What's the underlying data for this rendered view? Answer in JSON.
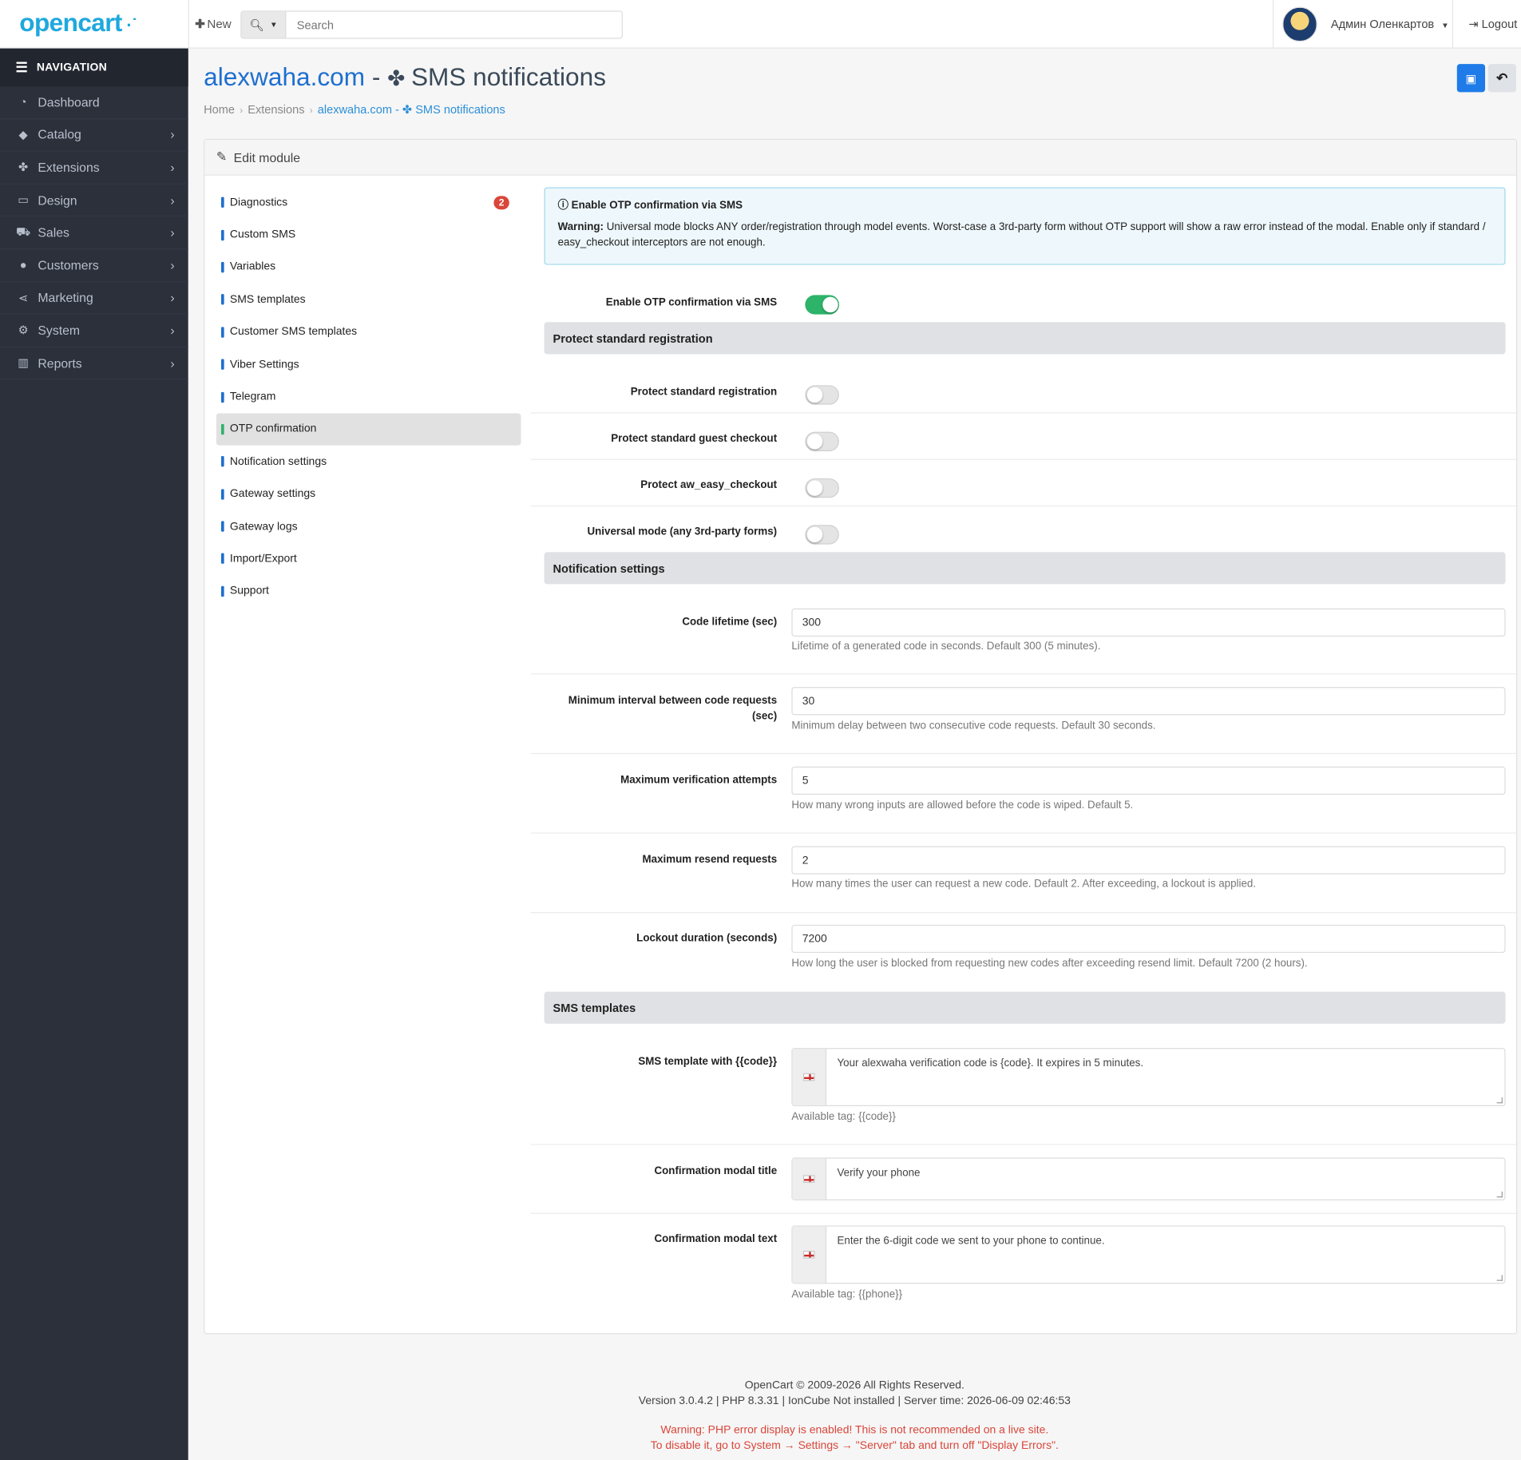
{
  "header": {
    "logo": "opencart",
    "new_label": "New",
    "search_placeholder": "Search",
    "user_name": "Админ Оленкартов",
    "logout_label": "Logout"
  },
  "navigation": {
    "title": "NAVIGATION",
    "items": [
      {
        "label": "Dashboard",
        "icon": "dashboard-icon"
      },
      {
        "label": "Catalog",
        "icon": "tags-icon"
      },
      {
        "label": "Extensions",
        "icon": "puzzle-icon"
      },
      {
        "label": "Design",
        "icon": "monitor-icon"
      },
      {
        "label": "Sales",
        "icon": "cart-icon"
      },
      {
        "label": "Customers",
        "icon": "user-icon"
      },
      {
        "label": "Marketing",
        "icon": "share-icon"
      },
      {
        "label": "System",
        "icon": "gear-icon"
      },
      {
        "label": "Reports",
        "icon": "chart-icon"
      }
    ]
  },
  "page": {
    "site": "alexwaha.com",
    "dash": " - ",
    "title": "SMS notifications",
    "breadcrumb": [
      "Home",
      "Extensions",
      "alexwaha.com - ",
      "SMS notifications"
    ]
  },
  "panel": {
    "title": "Edit module",
    "tabs": [
      {
        "label": "Diagnostics",
        "badge": "2"
      },
      {
        "label": "Custom SMS"
      },
      {
        "label": "Variables"
      },
      {
        "label": "SMS templates"
      },
      {
        "label": "Customer SMS templates"
      },
      {
        "label": "Viber Settings"
      },
      {
        "label": "Telegram"
      },
      {
        "label": "OTP confirmation",
        "active": true
      },
      {
        "label": "Notification settings"
      },
      {
        "label": "Gateway settings"
      },
      {
        "label": "Gateway logs"
      },
      {
        "label": "Import/Export"
      },
      {
        "label": "Support"
      }
    ]
  },
  "otp": {
    "alert_title": "Enable OTP confirmation via SMS",
    "alert_warning_label": "Warning:",
    "alert_text": "Universal mode blocks ANY order/registration through model events. Worst-case a 3rd-party form without OTP support will show a raw error instead of the modal. Enable only if standard / easy_checkout interceptors are not enough.",
    "enable_label": "Enable OTP confirmation via SMS",
    "enable_on": true,
    "section_protect": "Protect standard registration",
    "protect_registration_label": "Protect standard registration",
    "protect_guest_label": "Protect standard guest checkout",
    "protect_easy_label": "Protect aw_easy_checkout",
    "universal_label": "Universal mode (any 3rd-party forms)",
    "section_notification": "Notification settings",
    "code_lifetime_label": "Code lifetime (sec)",
    "code_lifetime_value": "300",
    "code_lifetime_help": "Lifetime of a generated code in seconds. Default 300 (5 minutes).",
    "min_interval_label_1": "Minimum interval between code requests",
    "min_interval_label_2": "(sec)",
    "min_interval_value": "30",
    "min_interval_help": "Minimum delay between two consecutive code requests. Default 30 seconds.",
    "max_attempts_label": "Maximum verification attempts",
    "max_attempts_value": "5",
    "max_attempts_help": "How many wrong inputs are allowed before the code is wiped. Default 5.",
    "max_resend_label": "Maximum resend requests",
    "max_resend_value": "2",
    "max_resend_help": "How many times the user can request a new code. Default 2. After exceeding, a lockout is applied.",
    "lockout_label": "Lockout duration (seconds)",
    "lockout_value": "7200",
    "lockout_help": "How long the user is blocked from requesting new codes after exceeding resend limit. Default 7200 (2 hours).",
    "section_templates": "SMS templates",
    "template_label": "SMS template with {{code}}",
    "template_value": "Your alexwaha verification code is {code}. It expires in 5 minutes.",
    "template_help": "Available tag: {{code}}",
    "modal_title_label": "Confirmation modal title",
    "modal_title_value": "Verify your phone",
    "modal_text_label": "Confirmation modal text",
    "modal_text_value": "Enter the 6-digit code we sent to your phone to continue.",
    "modal_text_help": "Available tag: {{phone}}"
  },
  "footer": {
    "line1": "OpenCart © 2009-2026 All Rights Reserved.",
    "line2": "Version 3.0.4.2 | PHP 8.3.31 | IonCube Not installed | Server time: 2026-06-09 02:46:53",
    "warn1": "Warning: PHP error display is enabled! This is not recommended on a live site.",
    "warn2": "To disable it, go to System → Settings → \"Server\" tab and turn off \"Display Errors\"."
  },
  "colors": {
    "accent": "#1e7be8",
    "sidebar": "#2b303b",
    "toggle_on": "#2db36a",
    "badge": "#d9463a"
  }
}
